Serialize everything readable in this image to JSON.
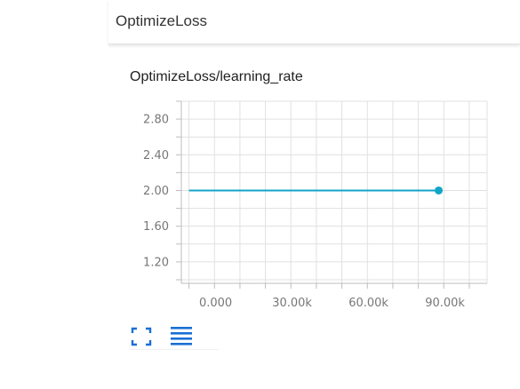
{
  "group": {
    "title": "OptimizeLoss"
  },
  "card": {
    "title": "OptimizeLoss/learning_rate"
  },
  "icons": {
    "expand": "fullscreen-icon",
    "data_table": "list-icon"
  },
  "colors": {
    "series": "#12a5c8",
    "grid": "#e0e0e0",
    "axis": "#bdbdbd",
    "icon": "#1a6fd4"
  },
  "chart_data": {
    "type": "line",
    "title": "OptimizeLoss/learning_rate",
    "xlim": [
      -3000,
      117000
    ],
    "ylim": [
      0.96,
      3.0
    ],
    "x_ticks": [
      0,
      30000,
      60000,
      90000
    ],
    "x_tick_labels": [
      "0.000",
      "30.00k",
      "60.00k",
      "90.00k"
    ],
    "y_ticks": [
      1.2,
      1.6,
      2.0,
      2.4,
      2.8
    ],
    "y_tick_labels": [
      "1.20",
      "1.60",
      "2.00",
      "2.40",
      "2.80"
    ],
    "grid": true,
    "series": [
      {
        "x": [
          0,
          98000
        ],
        "y": [
          2.0,
          2.0
        ],
        "marker_last": true
      }
    ]
  }
}
